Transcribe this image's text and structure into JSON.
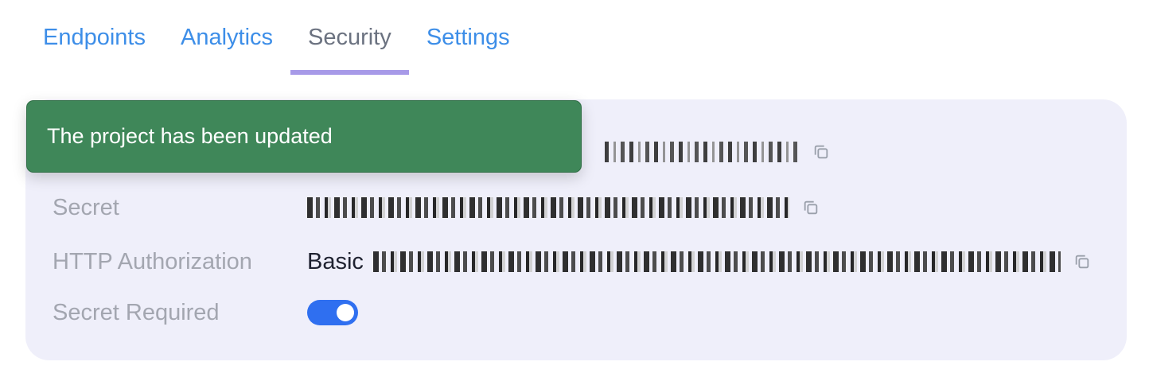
{
  "tabs": [
    {
      "label": "Endpoints",
      "active": false
    },
    {
      "label": "Analytics",
      "active": false
    },
    {
      "label": "Security",
      "active": true
    },
    {
      "label": "Settings",
      "active": false
    }
  ],
  "colors": {
    "tab_link": "#3d8ee8",
    "tab_active_text": "#6b7280",
    "tab_active_underline": "#a79ae8",
    "panel_bg": "#efeffa",
    "toast_bg": "#3f8759",
    "toggle_on": "#2f6ff0"
  },
  "security": {
    "rows": [
      {
        "label": "Secret",
        "value": "[redacted]"
      },
      {
        "label": "HTTP Authorization",
        "value_prefix": "Basic",
        "value": "[redacted]"
      },
      {
        "label": "Secret Required",
        "toggle_on": true
      }
    ],
    "obscured_row_value": "[redacted]"
  },
  "toast": {
    "message": "The project has been updated"
  },
  "icons": {
    "copy": "copy-icon"
  }
}
